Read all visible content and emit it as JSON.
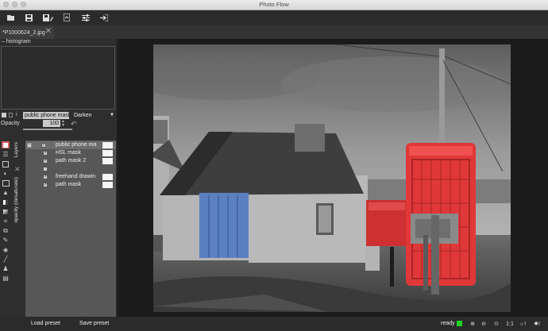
{
  "window": {
    "title": "Photo Flow"
  },
  "toolbar": {
    "buttons": [
      {
        "name": "open-icon"
      },
      {
        "name": "save-icon"
      },
      {
        "name": "save-as-icon"
      },
      {
        "name": "export-icon"
      },
      {
        "name": "settings-icon"
      },
      {
        "name": "exit-icon"
      }
    ]
  },
  "tabs": [
    {
      "label": "*P1000624_2.jpg",
      "close": "✕"
    }
  ],
  "histogram": {
    "toggle": "–",
    "label": "histogram"
  },
  "layer_controls": {
    "name_value": "public phone mask",
    "blend_mode": "Darken",
    "opacity_label": "Opacity",
    "opacity_value": "100"
  },
  "side_tabs": {
    "layers": "Layers",
    "properties": "opacity (desaturate)"
  },
  "layers": [
    {
      "name": "public phone ma",
      "level": 1,
      "checked": true,
      "group": true,
      "selected": true
    },
    {
      "name": "HSL mask",
      "level": 2,
      "checked": true
    },
    {
      "name": "path mask 2",
      "level": 2,
      "checked": true
    },
    {
      "name": "",
      "level": 2,
      "checked": false,
      "separator": true
    },
    {
      "name": "freehand drawin",
      "level": 2,
      "checked": true
    },
    {
      "name": "path mask",
      "level": 2,
      "checked": true
    }
  ],
  "bottom": {
    "load_preset": "Load preset",
    "save_preset": "Save preset",
    "status": "ready",
    "status_color": "#22d322",
    "zoom_one": "1:1"
  },
  "colors": {
    "phone_box": "#e03838",
    "door": "#5a80c0",
    "post_box": "#cc3030"
  }
}
